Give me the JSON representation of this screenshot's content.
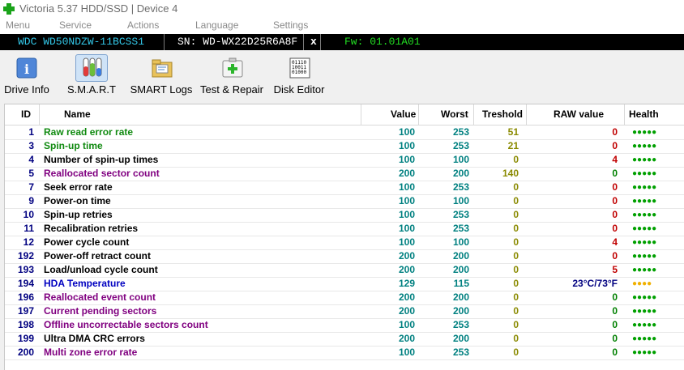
{
  "window": {
    "title": "Victoria 5.37 HDD/SSD | Device 4"
  },
  "menu": [
    "Menu",
    "Service",
    "Actions",
    "Language",
    "Settings"
  ],
  "drive": {
    "model": "WDC WD50NDZW-11BCSS1",
    "serial": "SN: WD-WX22D25R6A8F",
    "close": "x",
    "firmware": "Fw: 01.01A01"
  },
  "toolbar": [
    {
      "label": "Drive Info",
      "icon": "drive-info-icon"
    },
    {
      "label": "S.M.A.R.T",
      "icon": "smart-test-tubes-icon",
      "active": true
    },
    {
      "label": "SMART Logs",
      "icon": "folder-log-icon"
    },
    {
      "label": "Test & Repair",
      "icon": "first-aid-icon"
    },
    {
      "label": "Disk Editor",
      "icon": "binary-editor-icon"
    }
  ],
  "columns": {
    "id": "ID",
    "name": "Name",
    "value": "Value",
    "worst": "Worst",
    "treshold": "Treshold",
    "raw": "RAW value",
    "health": "Health"
  },
  "colors": {
    "green": "#108a10",
    "purple": "#800080",
    "black": "#000000",
    "blue": "#0000c0",
    "raw_red": "#c00000",
    "raw_green": "#008000",
    "raw_blue": "#000080",
    "health_green": "#00a000",
    "health_yellow": "#f0b000"
  },
  "rows": [
    {
      "id": "1",
      "name": "Raw read error rate",
      "value": "100",
      "worst": "253",
      "treshold": "51",
      "raw": "0",
      "health": "●●●●●",
      "name_color": "green",
      "raw_color": "raw_red",
      "health_color": "health_green"
    },
    {
      "id": "3",
      "name": "Spin-up time",
      "value": "100",
      "worst": "253",
      "treshold": "21",
      "raw": "0",
      "health": "●●●●●",
      "name_color": "green",
      "raw_color": "raw_red",
      "health_color": "health_green"
    },
    {
      "id": "4",
      "name": "Number of spin-up times",
      "value": "100",
      "worst": "100",
      "treshold": "0",
      "raw": "4",
      "health": "●●●●●",
      "name_color": "black",
      "raw_color": "raw_red",
      "health_color": "health_green"
    },
    {
      "id": "5",
      "name": "Reallocated sector count",
      "value": "200",
      "worst": "200",
      "treshold": "140",
      "raw": "0",
      "health": "●●●●●",
      "name_color": "purple",
      "raw_color": "raw_green",
      "health_color": "health_green"
    },
    {
      "id": "7",
      "name": "Seek error rate",
      "value": "100",
      "worst": "253",
      "treshold": "0",
      "raw": "0",
      "health": "●●●●●",
      "name_color": "black",
      "raw_color": "raw_red",
      "health_color": "health_green"
    },
    {
      "id": "9",
      "name": "Power-on time",
      "value": "100",
      "worst": "100",
      "treshold": "0",
      "raw": "0",
      "health": "●●●●●",
      "name_color": "black",
      "raw_color": "raw_red",
      "health_color": "health_green"
    },
    {
      "id": "10",
      "name": "Spin-up retries",
      "value": "100",
      "worst": "253",
      "treshold": "0",
      "raw": "0",
      "health": "●●●●●",
      "name_color": "black",
      "raw_color": "raw_red",
      "health_color": "health_green"
    },
    {
      "id": "11",
      "name": "Recalibration retries",
      "value": "100",
      "worst": "253",
      "treshold": "0",
      "raw": "0",
      "health": "●●●●●",
      "name_color": "black",
      "raw_color": "raw_red",
      "health_color": "health_green"
    },
    {
      "id": "12",
      "name": "Power cycle count",
      "value": "100",
      "worst": "100",
      "treshold": "0",
      "raw": "4",
      "health": "●●●●●",
      "name_color": "black",
      "raw_color": "raw_red",
      "health_color": "health_green"
    },
    {
      "id": "192",
      "name": "Power-off retract count",
      "value": "200",
      "worst": "200",
      "treshold": "0",
      "raw": "0",
      "health": "●●●●●",
      "name_color": "black",
      "raw_color": "raw_red",
      "health_color": "health_green"
    },
    {
      "id": "193",
      "name": "Load/unload cycle count",
      "value": "200",
      "worst": "200",
      "treshold": "0",
      "raw": "5",
      "health": "●●●●●",
      "name_color": "black",
      "raw_color": "raw_red",
      "health_color": "health_green"
    },
    {
      "id": "194",
      "name": "HDA Temperature",
      "value": "129",
      "worst": "115",
      "treshold": "0",
      "raw": "23°C/73°F",
      "health": "●●●●",
      "name_color": "blue",
      "raw_color": "raw_blue",
      "health_color": "health_yellow"
    },
    {
      "id": "196",
      "name": "Reallocated event count",
      "value": "200",
      "worst": "200",
      "treshold": "0",
      "raw": "0",
      "health": "●●●●●",
      "name_color": "purple",
      "raw_color": "raw_green",
      "health_color": "health_green"
    },
    {
      "id": "197",
      "name": "Current pending sectors",
      "value": "200",
      "worst": "200",
      "treshold": "0",
      "raw": "0",
      "health": "●●●●●",
      "name_color": "purple",
      "raw_color": "raw_green",
      "health_color": "health_green"
    },
    {
      "id": "198",
      "name": "Offline uncorrectable sectors count",
      "value": "100",
      "worst": "253",
      "treshold": "0",
      "raw": "0",
      "health": "●●●●●",
      "name_color": "purple",
      "raw_color": "raw_green",
      "health_color": "health_green"
    },
    {
      "id": "199",
      "name": "Ultra DMA CRC errors",
      "value": "200",
      "worst": "200",
      "treshold": "0",
      "raw": "0",
      "health": "●●●●●",
      "name_color": "black",
      "raw_color": "raw_green",
      "health_color": "health_green"
    },
    {
      "id": "200",
      "name": "Multi zone error rate",
      "value": "100",
      "worst": "253",
      "treshold": "0",
      "raw": "0",
      "health": "●●●●●",
      "name_color": "purple",
      "raw_color": "raw_green",
      "health_color": "health_green"
    }
  ]
}
